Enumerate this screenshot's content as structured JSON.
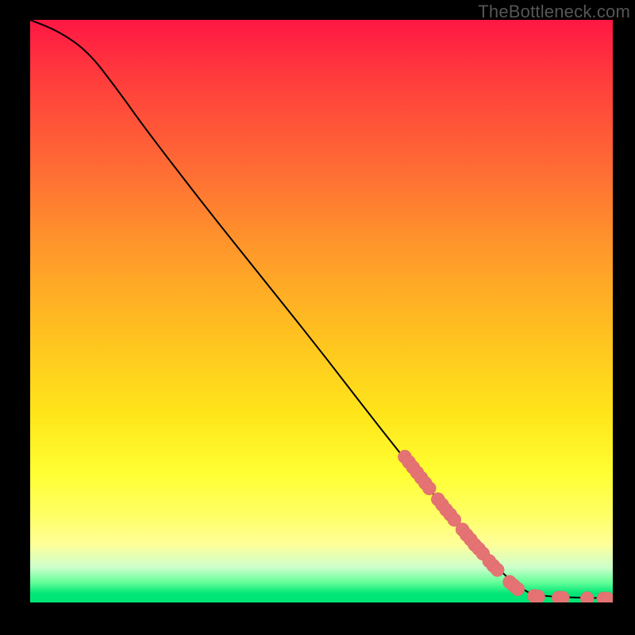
{
  "attribution": "TheBottleneck.com",
  "colors": {
    "frame": "#000000",
    "curve_stroke": "#000000",
    "marker_fill": "#e57373",
    "marker_stroke": "#d86a6a"
  },
  "chart_data": {
    "type": "line",
    "title": "",
    "xlabel": "",
    "ylabel": "",
    "xlim": [
      0,
      100
    ],
    "ylim": [
      0,
      100
    ],
    "grid": false,
    "legend": false,
    "curve": [
      {
        "x": 0,
        "y": 100
      },
      {
        "x": 5,
        "y": 98
      },
      {
        "x": 10,
        "y": 94.5
      },
      {
        "x": 15,
        "y": 88
      },
      {
        "x": 20,
        "y": 81
      },
      {
        "x": 30,
        "y": 68
      },
      {
        "x": 40,
        "y": 55.5
      },
      {
        "x": 50,
        "y": 43
      },
      {
        "x": 60,
        "y": 30
      },
      {
        "x": 70,
        "y": 17.5
      },
      {
        "x": 80,
        "y": 6
      },
      {
        "x": 84,
        "y": 2.5
      },
      {
        "x": 87,
        "y": 1
      },
      {
        "x": 100,
        "y": 0.7
      }
    ],
    "markers": [
      {
        "x": 64.3,
        "y": 25.0
      },
      {
        "x": 65.0,
        "y": 24.1
      },
      {
        "x": 65.7,
        "y": 23.2
      },
      {
        "x": 66.4,
        "y": 22.3
      },
      {
        "x": 67.1,
        "y": 21.4
      },
      {
        "x": 67.8,
        "y": 20.5
      },
      {
        "x": 68.5,
        "y": 19.6
      },
      {
        "x": 70.0,
        "y": 17.7
      },
      {
        "x": 70.7,
        "y": 16.8
      },
      {
        "x": 71.4,
        "y": 15.9
      },
      {
        "x": 72.1,
        "y": 15.1
      },
      {
        "x": 72.8,
        "y": 14.2
      },
      {
        "x": 74.2,
        "y": 12.5
      },
      {
        "x": 74.9,
        "y": 11.6
      },
      {
        "x": 75.6,
        "y": 10.8
      },
      {
        "x": 76.3,
        "y": 9.9
      },
      {
        "x": 77.0,
        "y": 9.2
      },
      {
        "x": 77.7,
        "y": 8.4
      },
      {
        "x": 78.8,
        "y": 7.1
      },
      {
        "x": 79.5,
        "y": 6.3
      },
      {
        "x": 80.2,
        "y": 5.6
      },
      {
        "x": 82.3,
        "y": 3.5
      },
      {
        "x": 83.0,
        "y": 2.9
      },
      {
        "x": 83.7,
        "y": 2.3
      },
      {
        "x": 86.5,
        "y": 1.1
      },
      {
        "x": 87.2,
        "y": 1.0
      },
      {
        "x": 90.7,
        "y": 0.8
      },
      {
        "x": 91.4,
        "y": 0.8
      },
      {
        "x": 95.6,
        "y": 0.7
      },
      {
        "x": 98.4,
        "y": 0.65
      },
      {
        "x": 99.1,
        "y": 0.65
      }
    ]
  }
}
